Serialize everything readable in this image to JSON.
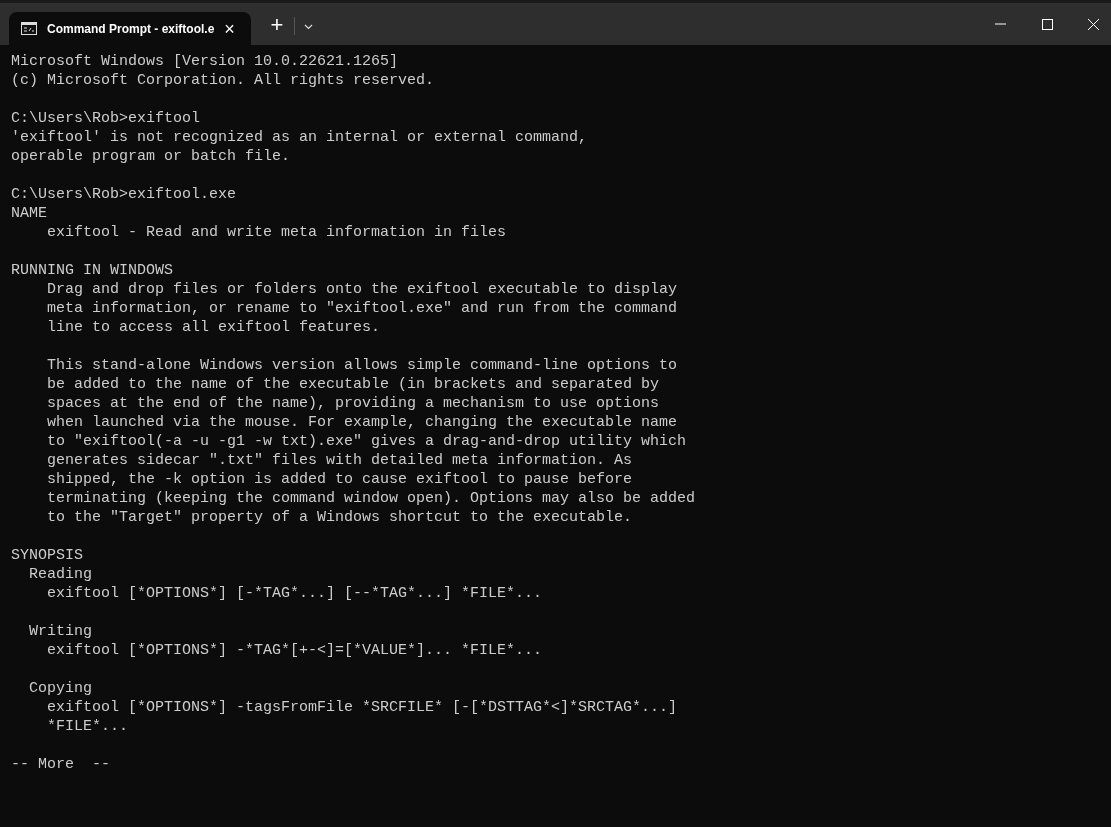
{
  "tab": {
    "title": "Command Prompt - exiftool.e",
    "close": "×"
  },
  "new_tab": "+",
  "blocks": [
    [
      "Microsoft Windows [Version 10.0.22621.1265]",
      "(c) Microsoft Corporation. All rights reserved."
    ],
    [
      "C:\\Users\\Rob>exiftool",
      "'exiftool' is not recognized as an internal or external command,",
      "operable program or batch file."
    ],
    [
      "C:\\Users\\Rob>exiftool.exe",
      "NAME",
      "    exiftool - Read and write meta information in files"
    ],
    [
      "RUNNING IN WINDOWS",
      "    Drag and drop files or folders onto the exiftool executable to display",
      "    meta information, or rename to \"exiftool.exe\" and run from the command",
      "    line to access all exiftool features."
    ],
    [
      "    This stand-alone Windows version allows simple command-line options to",
      "    be added to the name of the executable (in brackets and separated by",
      "    spaces at the end of the name), providing a mechanism to use options",
      "    when launched via the mouse. For example, changing the executable name",
      "    to \"exiftool(-a -u -g1 -w txt).exe\" gives a drag-and-drop utility which",
      "    generates sidecar \".txt\" files with detailed meta information. As",
      "    shipped, the -k option is added to cause exiftool to pause before",
      "    terminating (keeping the command window open). Options may also be added",
      "    to the \"Target\" property of a Windows shortcut to the executable."
    ],
    [
      "SYNOPSIS",
      "  Reading",
      "    exiftool [*OPTIONS*] [-*TAG*...] [--*TAG*...] *FILE*..."
    ],
    [
      "  Writing",
      "    exiftool [*OPTIONS*] -*TAG*[+-<]=[*VALUE*]... *FILE*..."
    ],
    [
      "  Copying",
      "    exiftool [*OPTIONS*] -tagsFromFile *SRCFILE* [-[*DSTTAG*<]*SRCTAG*...]",
      "    *FILE*..."
    ],
    [
      "-- More  --"
    ]
  ]
}
